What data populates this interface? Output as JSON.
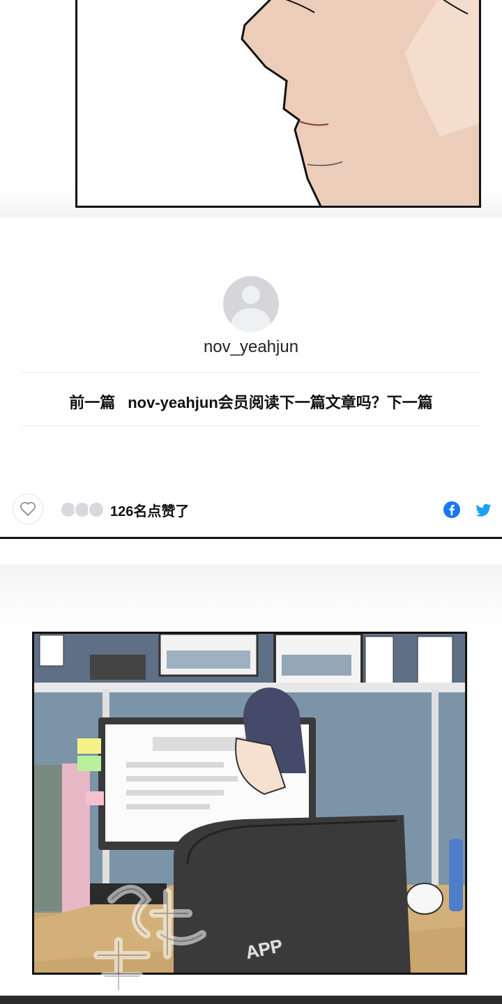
{
  "author": {
    "name": "nov_yeahjun"
  },
  "navigation": {
    "prev_label": "前一篇",
    "prompt": "nov-yeahjun会员阅读下一篇文章吗？下一篇"
  },
  "likes": {
    "count_text": "126名点赞了"
  },
  "share": {
    "facebook_icon": "facebook-icon",
    "twitter_icon": "twitter-icon"
  },
  "watermark": {
    "app_text": "APP"
  },
  "colors": {
    "facebook": "#1877f2",
    "twitter": "#1da1f2",
    "panel_border": "#111111"
  }
}
